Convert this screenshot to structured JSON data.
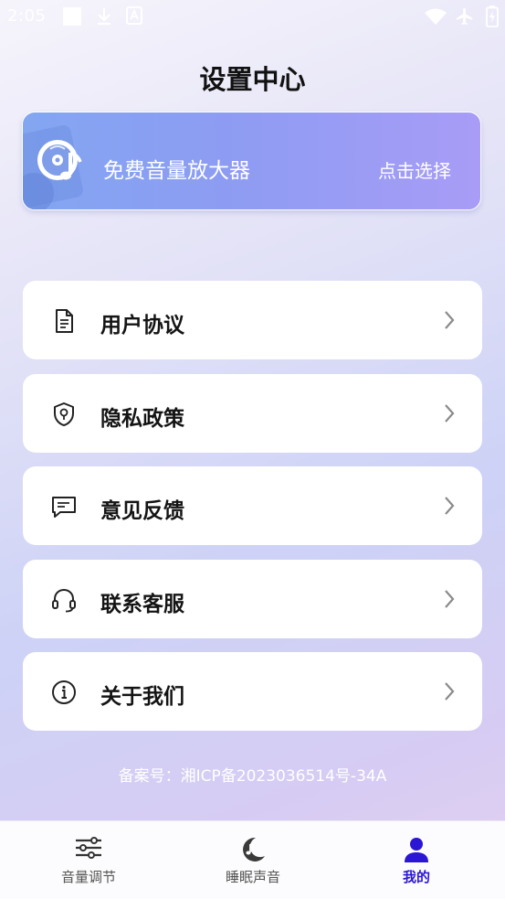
{
  "status_bar": {
    "time": "2:05"
  },
  "page": {
    "title": "设置中心"
  },
  "banner": {
    "label": "免费音量放大器",
    "action": "点击选择"
  },
  "menu": {
    "items": [
      {
        "label": "用户协议",
        "icon": "document-icon"
      },
      {
        "label": "隐私政策",
        "icon": "shield-icon"
      },
      {
        "label": "意见反馈",
        "icon": "feedback-icon"
      },
      {
        "label": "联系客服",
        "icon": "headset-icon"
      },
      {
        "label": "关于我们",
        "icon": "info-icon"
      }
    ]
  },
  "footer": {
    "icp": "备案号：湘ICP备2023036514号-34A"
  },
  "bottom_nav": {
    "items": [
      {
        "label": "音量调节",
        "icon": "sliders-icon"
      },
      {
        "label": "睡眠声音",
        "icon": "moon-icon"
      },
      {
        "label": "我的",
        "icon": "user-icon",
        "active": true
      }
    ]
  },
  "colors": {
    "accent": "#2b16d6",
    "banner_start": "#83a6f1",
    "banner_end": "#a89cf6"
  }
}
